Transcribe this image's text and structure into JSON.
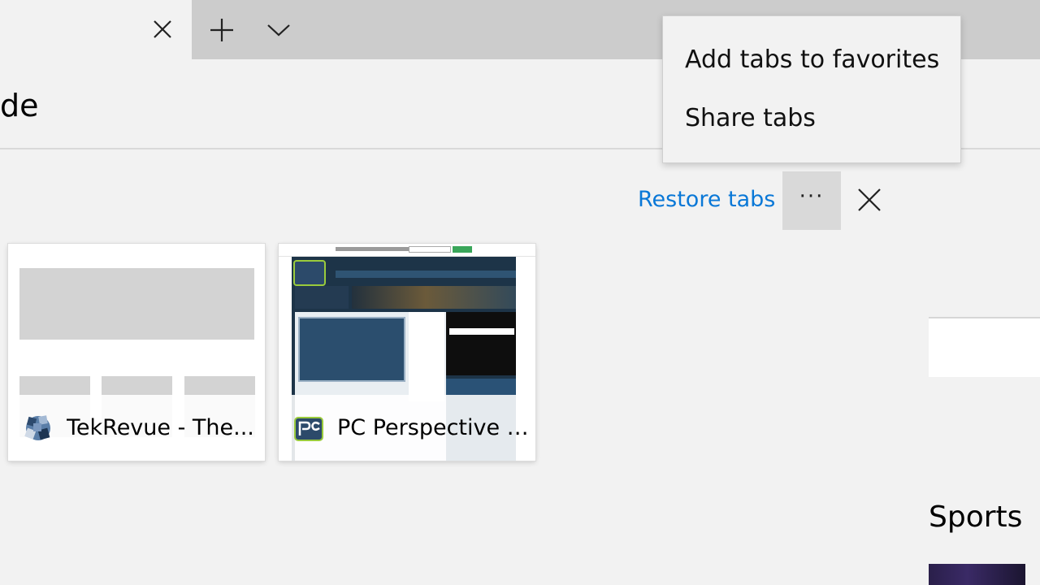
{
  "tab_strip": {
    "active_tab_close_icon": "close-icon",
    "new_tab_icon": "plus-icon",
    "tab_preview_icon": "chevron-down-icon"
  },
  "address_bar": {
    "partial_text": "de"
  },
  "set_aside_pane": {
    "restore_label": "Restore tabs",
    "more_label": "···",
    "close_icon": "close-icon",
    "accent": "#0a78d7",
    "tabs": [
      {
        "title": "TekRevue - The...",
        "favicon": "tekrevue-favicon"
      },
      {
        "title": "PC Perspective |...",
        "favicon": "pcper-favicon"
      }
    ]
  },
  "context_menu": {
    "items": [
      {
        "label": "Add tabs to favorites"
      },
      {
        "label": "Share tabs"
      }
    ]
  },
  "background_page": {
    "section_heading": "Sports"
  }
}
